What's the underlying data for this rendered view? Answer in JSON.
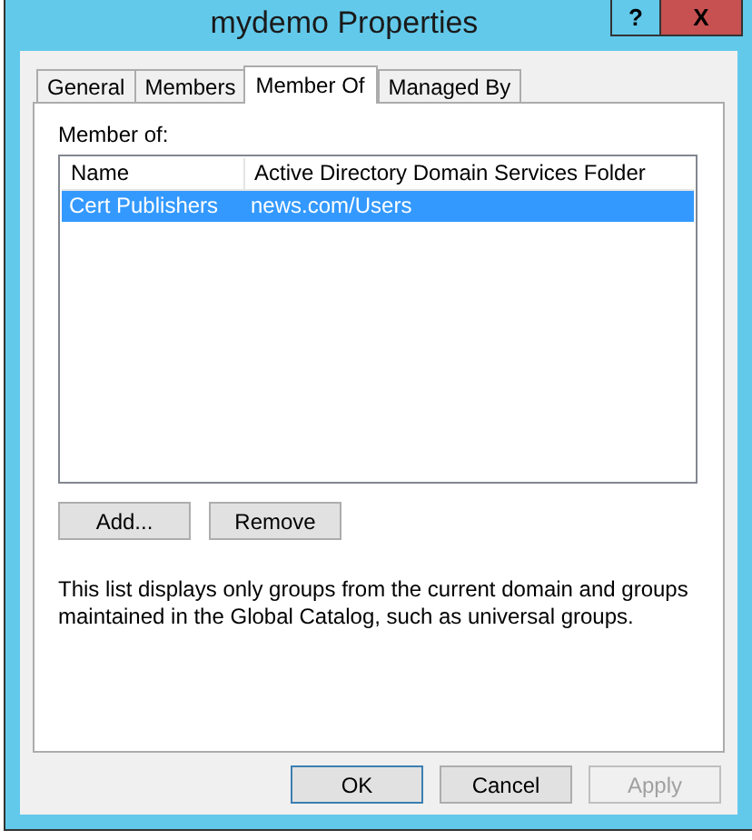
{
  "window": {
    "title": "mydemo Properties",
    "help": "?",
    "close": "X"
  },
  "tabs": [
    {
      "label": "General",
      "selected": false
    },
    {
      "label": "Members",
      "selected": false
    },
    {
      "label": "Member Of",
      "selected": true
    },
    {
      "label": "Managed By",
      "selected": false
    }
  ],
  "list_label": "Member of:",
  "table": {
    "columns": [
      "Name",
      "Active Directory Domain Services Folder"
    ],
    "rows": [
      {
        "cells": [
          "Cert Publishers",
          "news.com/Users"
        ],
        "selected": true
      }
    ]
  },
  "list_buttons": [
    "Add...",
    "Remove"
  ],
  "note": "This list displays only groups from the current domain and groups maintained in the Global Catalog, such as universal groups.",
  "buttons": [
    {
      "label": "OK",
      "default": true,
      "disabled": false
    },
    {
      "label": "Cancel",
      "default": false,
      "disabled": false
    },
    {
      "label": "Apply",
      "default": false,
      "disabled": true
    }
  ]
}
